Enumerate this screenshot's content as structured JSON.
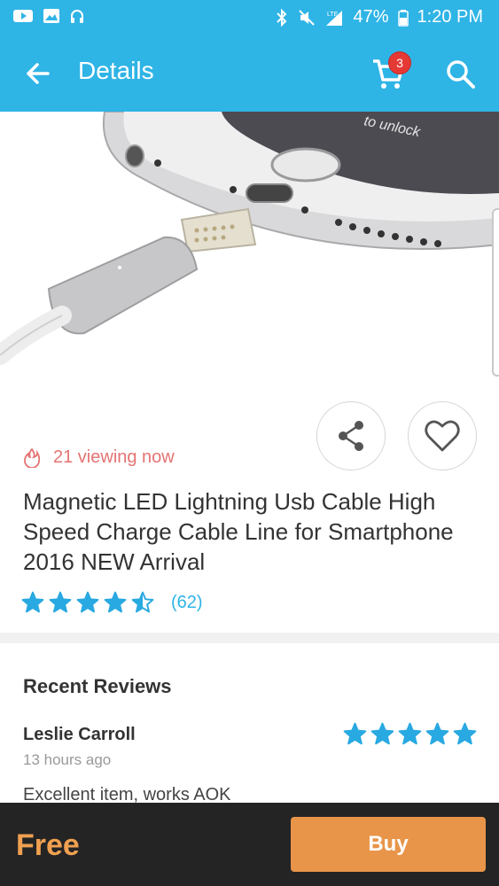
{
  "status_bar": {
    "battery": "47%",
    "time": "1:20 PM",
    "network": "LTE"
  },
  "header": {
    "title": "Details",
    "cart_count": "3"
  },
  "product": {
    "viewing": "21 viewing now",
    "title": "Magnetic LED Lightning Usb Cable High Speed Charge Cable Line for Smartphone 2016 NEW Arrival",
    "rating": 4.5,
    "rating_count": "(62)"
  },
  "reviews": {
    "heading": "Recent Reviews",
    "items": [
      {
        "author": "Leslie Carroll",
        "time": "13 hours ago",
        "rating": 5,
        "text": "Excellent item, works AOK"
      }
    ]
  },
  "bottom": {
    "price": "Free",
    "buy_label": "Buy"
  },
  "hero_image": {
    "screen_text": "to unlock"
  },
  "colors": {
    "primary": "#2fb4e6",
    "accent": "#e8954a",
    "price": "#f0a050",
    "badge": "#e53935",
    "viewing": "#e57373",
    "star": "#29a9e1"
  },
  "icons": [
    "youtube-icon",
    "image-icon",
    "headphones-icon",
    "bluetooth-icon",
    "mute-icon",
    "signal-icon",
    "battery-icon",
    "back-arrow-icon",
    "cart-icon",
    "search-icon",
    "share-icon",
    "heart-icon",
    "fire-icon",
    "star-icon"
  ]
}
